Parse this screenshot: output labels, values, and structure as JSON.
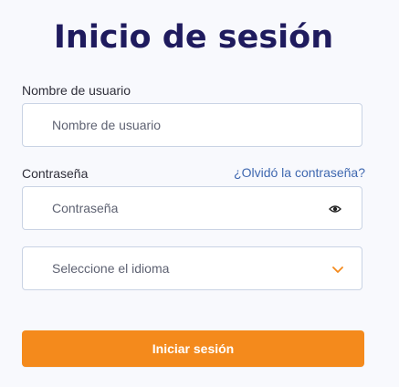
{
  "page": {
    "title": "Inicio de sesión"
  },
  "username": {
    "label": "Nombre de usuario",
    "placeholder": "Nombre de usuario",
    "value": ""
  },
  "password": {
    "label": "Contraseña",
    "forgot_link": "¿Olvidó la contraseña?",
    "placeholder": "Contraseña",
    "value": "",
    "toggle_icon": "eye-icon"
  },
  "language": {
    "selected": "Seleccione el idioma",
    "icon": "chevron-down-icon"
  },
  "actions": {
    "login_label": "Iniciar sesión"
  },
  "colors": {
    "accent": "#f48a1c",
    "title": "#1f1b5e",
    "link": "#3f68b0"
  }
}
